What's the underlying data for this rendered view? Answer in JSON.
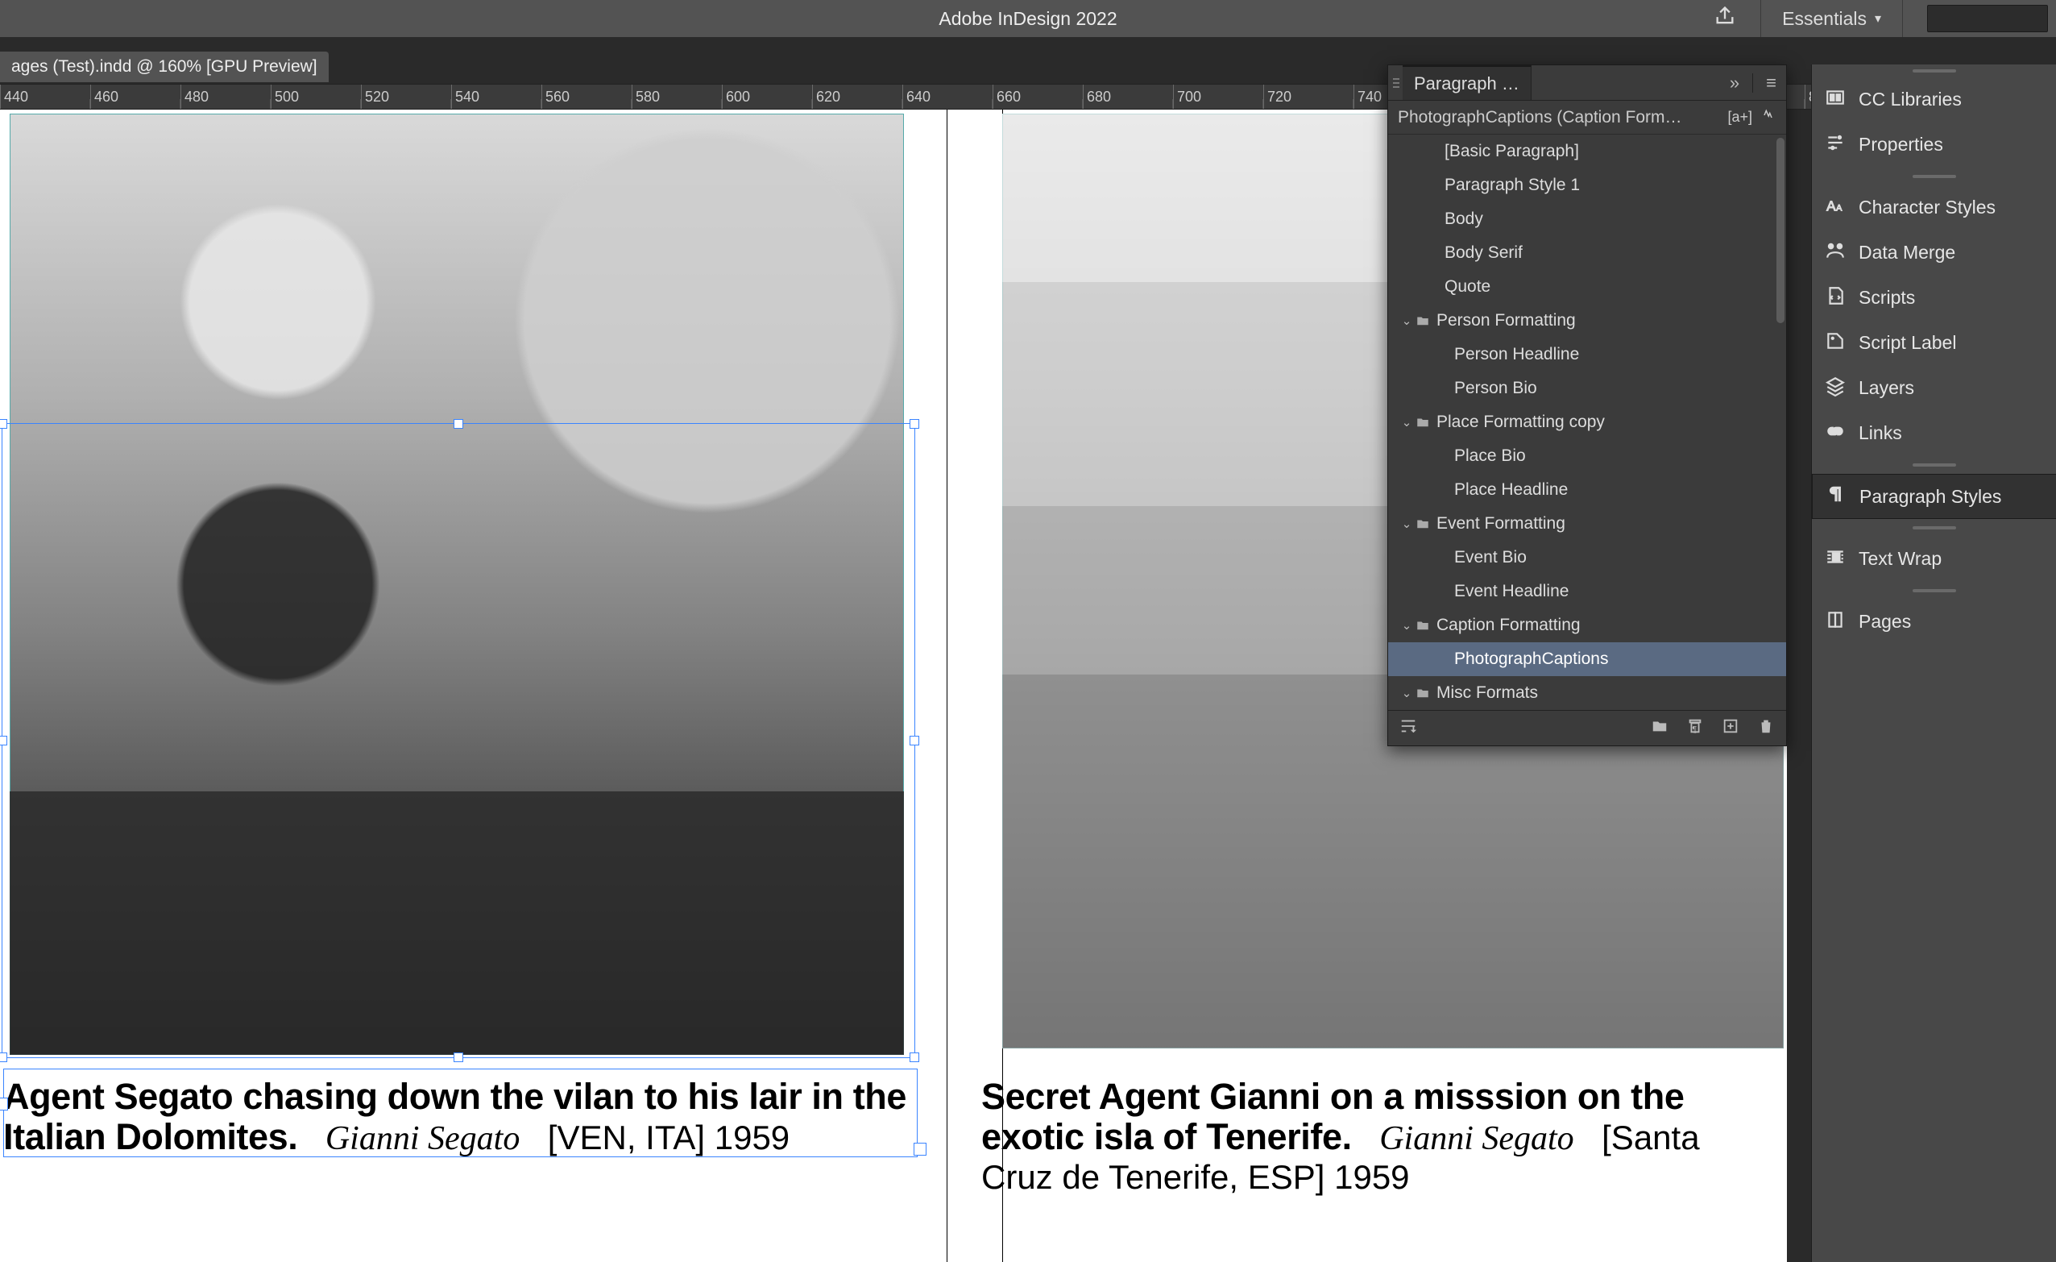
{
  "app": {
    "title": "Adobe InDesign 2022",
    "workspace": "Essentials"
  },
  "document": {
    "tab": "ages (Test).indd @ 160% [GPU Preview]"
  },
  "ruler": {
    "start": 440,
    "step": 20
  },
  "captions": {
    "left": {
      "bold": "Agent Segato chasing down the vilan to his lair in the Italian Dolomites.",
      "ital": "Gianni Segato",
      "meta": "[VEN, ITA]  1959"
    },
    "right": {
      "bold": "Secret Agent Gianni on a misssion on the exotic isla of Tenerife.",
      "ital": "Gianni Segato",
      "meta": "[Santa Cruz de Tenerife, ESP]  1959"
    }
  },
  "para_panel": {
    "tab": "Paragraph …",
    "header": "PhotographCaptions (Caption Form…",
    "header_badge": "[a+]",
    "styles": [
      {
        "label": "[Basic Paragraph]",
        "indent": 1
      },
      {
        "label": "Paragraph Style 1",
        "indent": 1
      },
      {
        "label": "Body",
        "indent": 1
      },
      {
        "label": "Body Serif",
        "indent": 1
      },
      {
        "label": "Quote",
        "indent": 1
      },
      {
        "label": "Person Formatting",
        "indent": 0,
        "folder": true
      },
      {
        "label": "Person Headline",
        "indent": 2
      },
      {
        "label": "Person Bio",
        "indent": 2
      },
      {
        "label": "Place Formatting copy",
        "indent": 0,
        "folder": true
      },
      {
        "label": "Place Bio",
        "indent": 2
      },
      {
        "label": "Place Headline",
        "indent": 2
      },
      {
        "label": "Event Formatting",
        "indent": 0,
        "folder": true
      },
      {
        "label": "Event Bio",
        "indent": 2
      },
      {
        "label": "Event Headline",
        "indent": 2
      },
      {
        "label": "Caption Formatting",
        "indent": 0,
        "folder": true
      },
      {
        "label": "PhotographCaptions",
        "indent": 2,
        "selected": true
      },
      {
        "label": "Misc Formats",
        "indent": 0,
        "folder": true
      }
    ]
  },
  "dock": {
    "items": [
      "CC Libraries",
      "Properties",
      "Character Styles",
      "Data Merge",
      "Scripts",
      "Script Label",
      "Layers",
      "Links",
      "Paragraph Styles",
      "Text Wrap",
      "Pages"
    ],
    "selected": "Paragraph Styles"
  }
}
